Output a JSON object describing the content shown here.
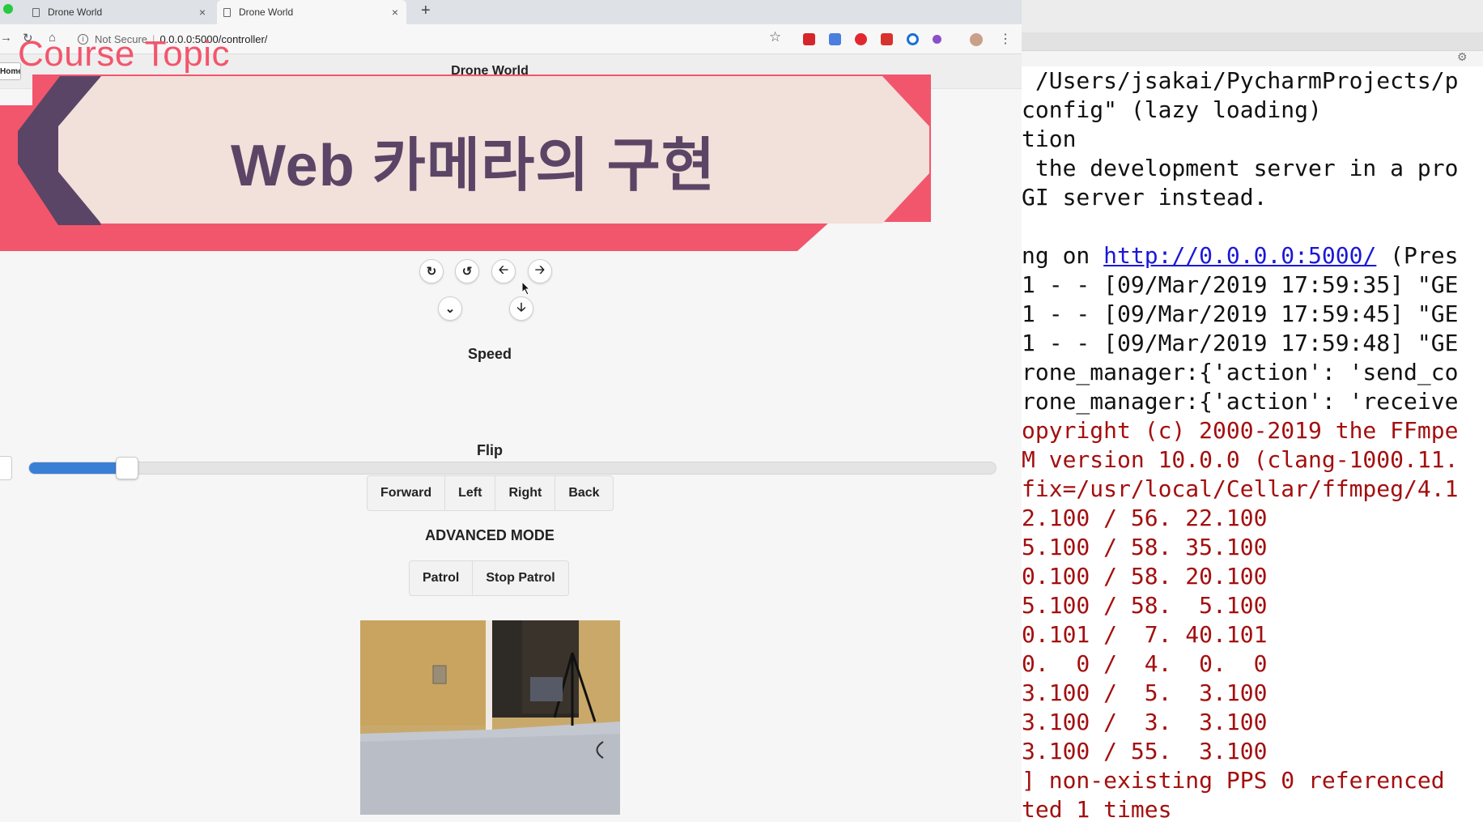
{
  "browser": {
    "tabs": [
      {
        "label": "Drone World",
        "close": "×"
      },
      {
        "label": "Drone World",
        "close": "×"
      }
    ],
    "new_tab": "+",
    "security_label": "Not Secure",
    "separator": "|",
    "url": "0.0.0.0:5000/controller/"
  },
  "page": {
    "home_label": "Home",
    "site_title": "Drone World",
    "speed_label": "Speed",
    "speed_value_percent": 9,
    "flip_label": "Flip",
    "flip_buttons": [
      "Forward",
      "Left",
      "Right",
      "Back"
    ],
    "advanced_label": "ADVANCED MODE",
    "advanced_buttons": [
      "Patrol",
      "Stop Patrol"
    ],
    "controls": {
      "row1": [
        "rotate-cw-icon",
        "rotate-ccw-icon",
        "arrow-left-icon",
        "arrow-right-icon"
      ],
      "row2": [
        "chevron-down-icon",
        "arrow-down-icon"
      ]
    }
  },
  "overlay": {
    "course_topic": "Course Topic",
    "banner_title": "Web 카메라의 구현",
    "colors": {
      "pink": "#f2566c",
      "purple": "#5b4566",
      "beige": "#f2e0da"
    }
  },
  "terminal": {
    "lines": [
      {
        "text": " /Users/jsakai/PycharmProjects/p",
        "color": "black"
      },
      {
        "text": "config\" (lazy loading)",
        "color": "black"
      },
      {
        "text": "tion",
        "color": "black"
      },
      {
        "text": " the development server in a pro",
        "color": "black"
      },
      {
        "text": "GI server instead.",
        "color": "black"
      },
      {
        "text": "",
        "color": "black"
      },
      {
        "text": "ng on ",
        "link": "http://0.0.0.0:5000/",
        "suffix": " (Pres",
        "color": "black"
      },
      {
        "text": "1 - - [09/Mar/2019 17:59:35] \"GE",
        "color": "black"
      },
      {
        "text": "1 - - [09/Mar/2019 17:59:45] \"GE",
        "color": "black"
      },
      {
        "text": "1 - - [09/Mar/2019 17:59:48] \"GE",
        "color": "black"
      },
      {
        "text": "rone_manager:{'action': 'send_co",
        "color": "black"
      },
      {
        "text": "rone_manager:{'action': 'receive",
        "color": "black"
      },
      {
        "text": "opyright (c) 2000-2019 the FFmpe",
        "color": "red"
      },
      {
        "text": "M version 10.0.0 (clang-1000.11.",
        "color": "red"
      },
      {
        "text": "fix=/usr/local/Cellar/ffmpeg/4.1",
        "color": "red"
      },
      {
        "text": "2.100 / 56. 22.100",
        "color": "red"
      },
      {
        "text": "5.100 / 58. 35.100",
        "color": "red"
      },
      {
        "text": "0.100 / 58. 20.100",
        "color": "red"
      },
      {
        "text": "5.100 / 58.  5.100",
        "color": "red"
      },
      {
        "text": "0.101 /  7. 40.101",
        "color": "red"
      },
      {
        "text": "0.  0 /  4.  0.  0",
        "color": "red"
      },
      {
        "text": "3.100 /  5.  3.100",
        "color": "red"
      },
      {
        "text": "3.100 /  3.  3.100",
        "color": "red"
      },
      {
        "text": "3.100 / 55.  3.100",
        "color": "red"
      },
      {
        "text": "] non-existing PPS 0 referenced",
        "color": "red"
      },
      {
        "text": "ted 1 times",
        "color": "red"
      }
    ]
  }
}
